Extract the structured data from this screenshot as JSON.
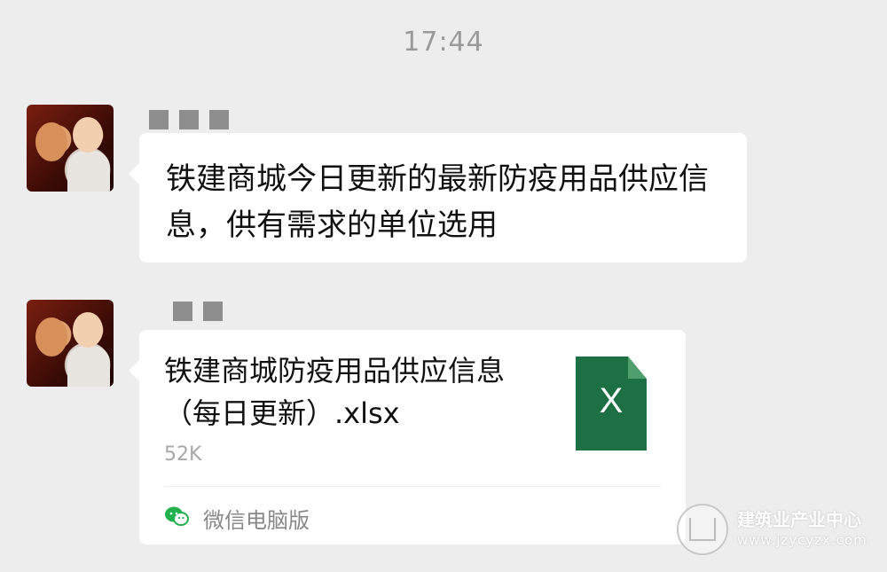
{
  "chat": {
    "timestamp": "17:44",
    "messages": [
      {
        "type": "text",
        "text": "铁建商城今日更新的最新防疫用品供应信息，供有需求的单位选用"
      },
      {
        "type": "file",
        "file_name": "铁建商城防疫用品供应信息（每日更新）.xlsx",
        "file_size": "52K",
        "file_icon_label": "X",
        "source_label": "微信电脑版"
      }
    ]
  },
  "watermark": {
    "title": "建筑业产业中心",
    "url": "www.jzycyzx.com"
  },
  "colors": {
    "background": "#ededed",
    "bubble": "#ffffff",
    "excel_green": "#1d7044",
    "wechat_green": "#22b14c"
  },
  "icons": {
    "file": "excel-file-icon",
    "source": "wechat-icon"
  }
}
